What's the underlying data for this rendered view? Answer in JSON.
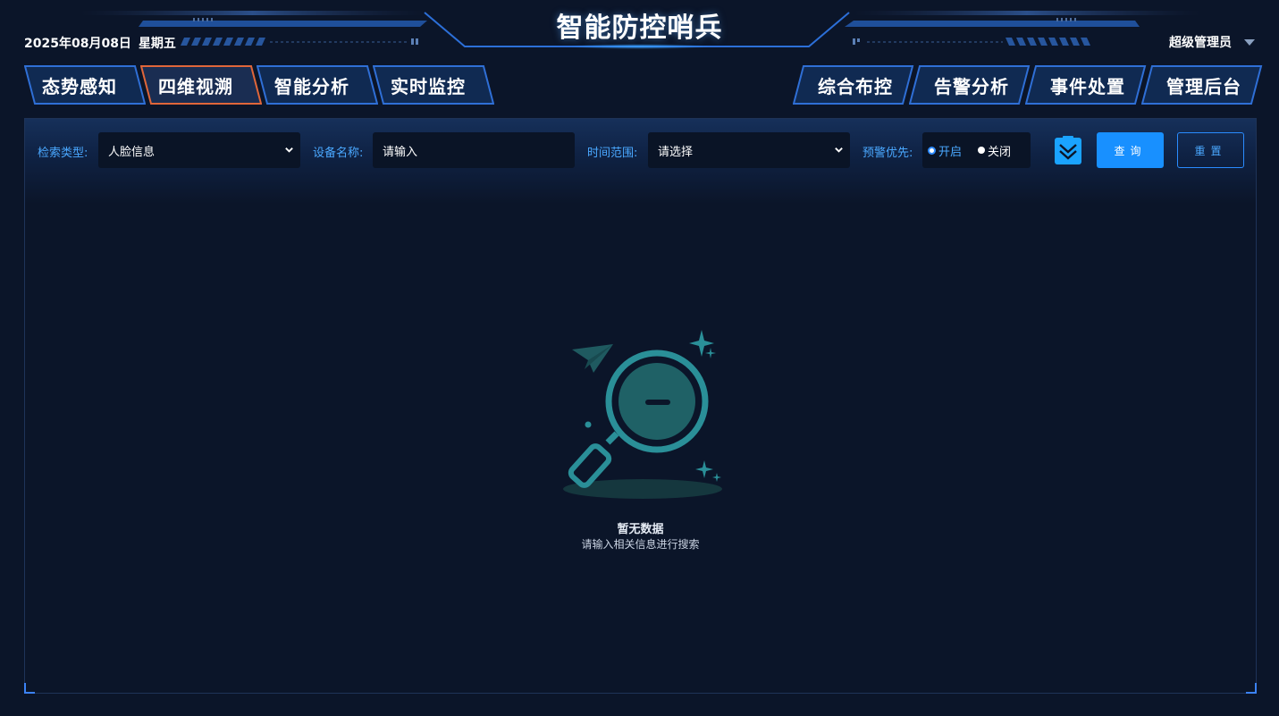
{
  "header": {
    "title": "智能防控哨兵",
    "date": "2025年08月08日",
    "weekday": "星期五",
    "user": "超级管理员"
  },
  "nav_left": [
    {
      "label": "态势感知",
      "active": false
    },
    {
      "label": "四维视溯",
      "active": true
    },
    {
      "label": "智能分析",
      "active": false
    },
    {
      "label": "实时监控",
      "active": false
    }
  ],
  "nav_right": [
    {
      "label": "综合布控"
    },
    {
      "label": "告警分析"
    },
    {
      "label": "事件处置"
    },
    {
      "label": "管理后台"
    }
  ],
  "filters": {
    "search_type": {
      "label": "检索类型:",
      "value": "人脸信息"
    },
    "device_name": {
      "label": "设备名称:",
      "placeholder": "请输入"
    },
    "time_range": {
      "label": "时间范围:",
      "value": "请选择"
    },
    "alert_priority": {
      "label": "预警优先:",
      "options": [
        "开启",
        "关闭"
      ],
      "selected": "开启"
    }
  },
  "buttons": {
    "query": "查询",
    "reset": "重置"
  },
  "empty_state": {
    "title": "暂无数据",
    "subtitle": "请输入相关信息进行搜索"
  },
  "colors": {
    "accent": "#1890ff",
    "label": "#4aa8ff",
    "active_tab_border": "#e0663a",
    "tab_border": "#2f6fd6",
    "empty_icon": "#2a8f98"
  }
}
